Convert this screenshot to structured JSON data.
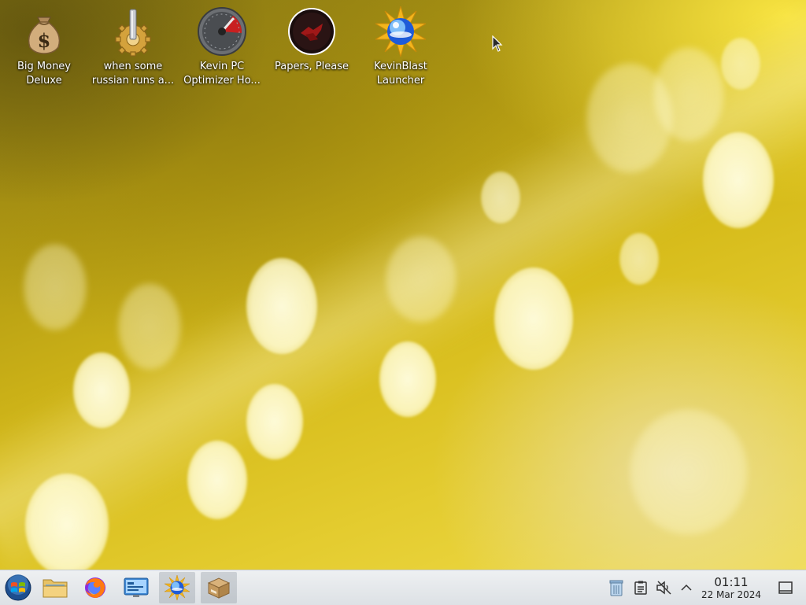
{
  "desktop": {
    "icons": [
      {
        "label": "Big Money\nDeluxe",
        "icon": "money-bag-icon"
      },
      {
        "label": "when some\nrussian runs a...",
        "icon": "gear-app-icon"
      },
      {
        "label": "Kevin PC\nOptimizer Ho...",
        "icon": "speedometer-icon"
      },
      {
        "label": "Papers, Please",
        "icon": "papers-please-icon"
      },
      {
        "label": "KevinBlast\nLauncher",
        "icon": "kevinblast-icon"
      }
    ]
  },
  "taskbar": {
    "start": {
      "icon": "start-orb-icon"
    },
    "pinned": [
      {
        "name": "file-manager",
        "icon": "folder-icon",
        "active": false
      },
      {
        "name": "firefox",
        "icon": "firefox-icon",
        "active": false
      },
      {
        "name": "control-panel",
        "icon": "control-panel-icon",
        "active": false
      },
      {
        "name": "kevinblast",
        "icon": "kevinblast-icon",
        "active": true
      },
      {
        "name": "package-installer",
        "icon": "package-icon",
        "active": true
      }
    ],
    "tray": [
      {
        "name": "recycle-bin",
        "icon": "recycle-bin-icon"
      },
      {
        "name": "clipboard",
        "icon": "clipboard-icon"
      },
      {
        "name": "volume-muted",
        "icon": "volume-muted-icon"
      },
      {
        "name": "show-hidden",
        "icon": "chevron-up-icon"
      }
    ],
    "clock": {
      "time": "01:11",
      "date": "22 Mar 2024"
    },
    "show_desktop": {
      "icon": "show-desktop-icon"
    }
  },
  "colors": {
    "wallpaper_primary": "#d6bb1a",
    "taskbar_bg": "#e6e9ec",
    "label_text": "#ffffff"
  }
}
